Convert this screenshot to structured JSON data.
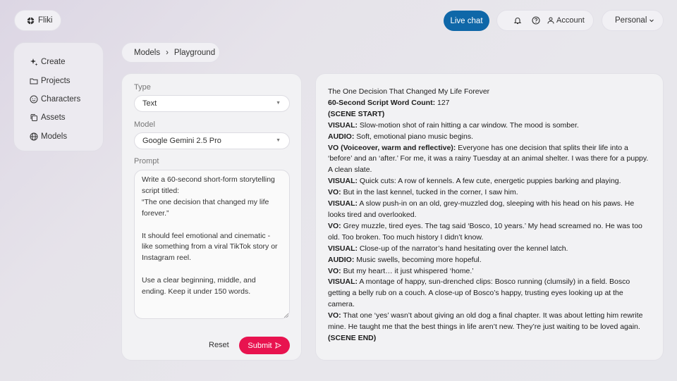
{
  "header": {
    "brand": "Fliki",
    "live_chat": "Live chat",
    "account": "Account",
    "workspace": "Personal"
  },
  "sidebar": {
    "items": [
      {
        "label": "Create",
        "icon": "sparkle-icon"
      },
      {
        "label": "Projects",
        "icon": "folder-icon"
      },
      {
        "label": "Characters",
        "icon": "smile-icon"
      },
      {
        "label": "Assets",
        "icon": "copy-icon"
      },
      {
        "label": "Models",
        "icon": "globe-icon"
      }
    ]
  },
  "breadcrumb": {
    "root": "Models",
    "separator": "›",
    "current": "Playground"
  },
  "form": {
    "type_label": "Type",
    "type_value": "Text",
    "model_label": "Model",
    "model_value": "Google Gemini 2.5 Pro",
    "prompt_label": "Prompt",
    "prompt_value": "Write a 60-second short-form storytelling script titled:\n“The one decision that changed my life forever.”\n\nIt should feel emotional and cinematic - like something from a viral TikTok story or Instagram reel.\n\nUse a clear beginning, middle, and ending. Keep it under 150 words.",
    "reset_label": "Reset",
    "submit_label": "Submit"
  },
  "output": {
    "lines": [
      {
        "bold": "",
        "text": "The One Decision That Changed My Life Forever"
      },
      {
        "bold": "60-Second Script Word Count:",
        "text": " 127"
      },
      {
        "bold": "(SCENE START)",
        "text": ""
      },
      {
        "bold": "VISUAL:",
        "text": " Slow-motion shot of rain hitting a car window. The mood is somber."
      },
      {
        "bold": "AUDIO:",
        "text": " Soft, emotional piano music begins."
      },
      {
        "bold": "VO (Voiceover, warm and reflective):",
        "text": " Everyone has one decision that splits their life into a ‘before’ and an ‘after.’ For me, it was a rainy Tuesday at an animal shelter. I was there for a puppy. A clean slate."
      },
      {
        "bold": "VISUAL:",
        "text": " Quick cuts: A row of kennels. A few cute, energetic puppies barking and playing."
      },
      {
        "bold": "VO:",
        "text": " But in the last kennel, tucked in the corner, I saw him."
      },
      {
        "bold": "VISUAL:",
        "text": " A slow push-in on an old, grey-muzzled dog, sleeping with his head on his paws. He looks tired and overlooked."
      },
      {
        "bold": "VO:",
        "text": " Grey muzzle, tired eyes. The tag said ‘Bosco, 10 years.’ My head screamed no. He was too old. Too broken. Too much history I didn’t know."
      },
      {
        "bold": "VISUAL:",
        "text": " Close-up of the narrator’s hand hesitating over the kennel latch."
      },
      {
        "bold": "AUDIO:",
        "text": " Music swells, becoming more hopeful."
      },
      {
        "bold": "VO:",
        "text": " But my heart… it just whispered ‘home.’"
      },
      {
        "bold": "VISUAL:",
        "text": " A montage of happy, sun-drenched clips: Bosco running (clumsily) in a field. Bosco getting a belly rub on a couch. A close-up of Bosco’s happy, trusting eyes looking up at the camera."
      },
      {
        "bold": "VO:",
        "text": " That one ‘yes’ wasn’t about giving an old dog a final chapter. It was about letting him rewrite mine. He taught me that the best things in life aren’t new. They’re just waiting to be loved again."
      },
      {
        "bold": "(SCENE END)",
        "text": ""
      }
    ]
  },
  "colors": {
    "live_chat": "#0f67a8",
    "submit": "#e8134f"
  }
}
